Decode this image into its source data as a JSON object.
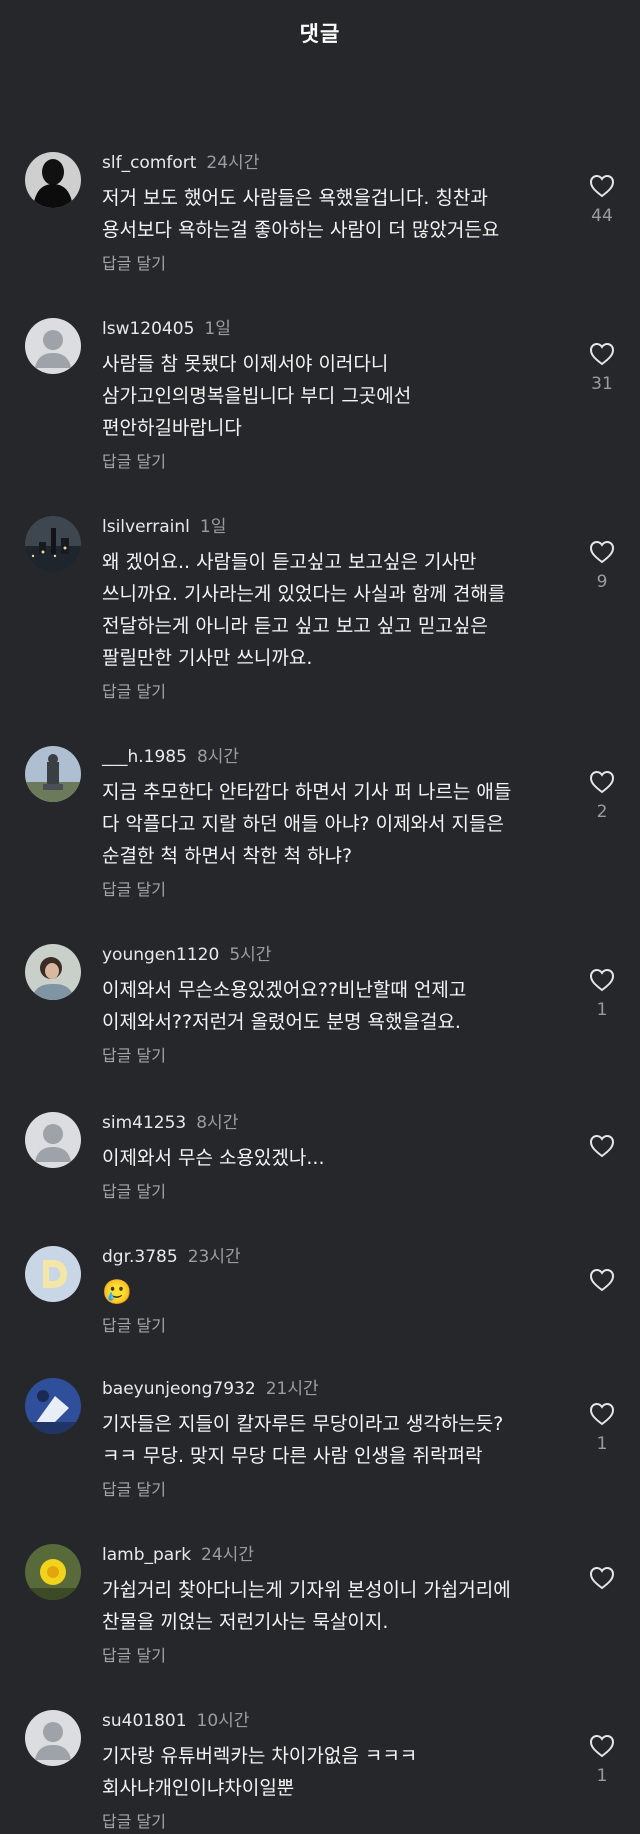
{
  "header": {
    "title": "댓글"
  },
  "reply_label": "답글 달기",
  "comments": [
    {
      "username": "slf_comfort",
      "time": "24시간",
      "lines": [
        "저거 보도 했어도 사람들은 욕했을겁니다. 칭찬과",
        "용서보다 욕하는걸 좋아하는 사람이 더 많았거든요"
      ],
      "likes": "44",
      "avatar": "dark-silhouette"
    },
    {
      "username": "lsw120405",
      "time": "1일",
      "lines": [
        "사람들 참 못됐다 이제서야 이러다니",
        "삼가고인의명복을빕니다 부디 그곳에선",
        "편안하길바랍니다"
      ],
      "likes": "31",
      "avatar": "default"
    },
    {
      "username": "lsilverrainl",
      "time": "1일",
      "lines": [
        "왜 겠어요.. 사람들이 듣고싶고 보고싶은 기사만",
        "쓰니까요. 기사라는게 있었다는 사실과 함께 견해를",
        "전달하는게 아니라 듣고 싶고 보고 싶고 믿고싶은",
        "팔릴만한 기사만 쓰니까요."
      ],
      "likes": "9",
      "avatar": "night-city"
    },
    {
      "username": "___h.1985",
      "time": "8시간",
      "lines": [
        "지금 추모한다 안타깝다 하면서 기사 퍼 나르는 애들",
        "다 악플다고 지랄 하던 애들 아냐? 이제와서 지들은",
        "순결한 척 하면서 착한 척 하냐?"
      ],
      "likes": "2",
      "avatar": "statue"
    },
    {
      "username": "youngen1120",
      "time": "5시간",
      "lines": [
        "이제와서 무슨소용있겠어요??비난할때 언제고",
        "이제와서??저런거 올렸어도 분명 욕했을걸요."
      ],
      "likes": "1",
      "avatar": "person-photo"
    },
    {
      "username": "sim41253",
      "time": "8시간",
      "lines": [
        "이제와서 무슨 소용있겠나..."
      ],
      "likes": "",
      "avatar": "default"
    },
    {
      "username": "dgr.3785",
      "time": "23시간",
      "lines": [
        "🥲"
      ],
      "likes": "",
      "avatar": "letter-d"
    },
    {
      "username": "baeyunjeong7932",
      "time": "21시간",
      "lines": [
        "기자들은 지들이 칼자루든 무당이라고 생각하는듯?",
        "ㅋㅋ 무당. 맞지 무당 다른 사람 인생을 쥐락펴락"
      ],
      "likes": "1",
      "avatar": "blue-sky"
    },
    {
      "username": "lamb_park",
      "time": "24시간",
      "lines": [
        "가쉽거리 찾아다니는게 기자위 본성이니 가쉽거리에",
        "찬물을 끼얹는 저런기사는 묵살이지."
      ],
      "likes": "",
      "avatar": "dandelion"
    },
    {
      "username": "su401801",
      "time": "10시간",
      "lines": [
        "기자랑 유튜버렉카는 차이가없음 ㅋㅋㅋ",
        "회사냐개인이냐차이일뿐"
      ],
      "likes": "1",
      "avatar": "default"
    }
  ]
}
